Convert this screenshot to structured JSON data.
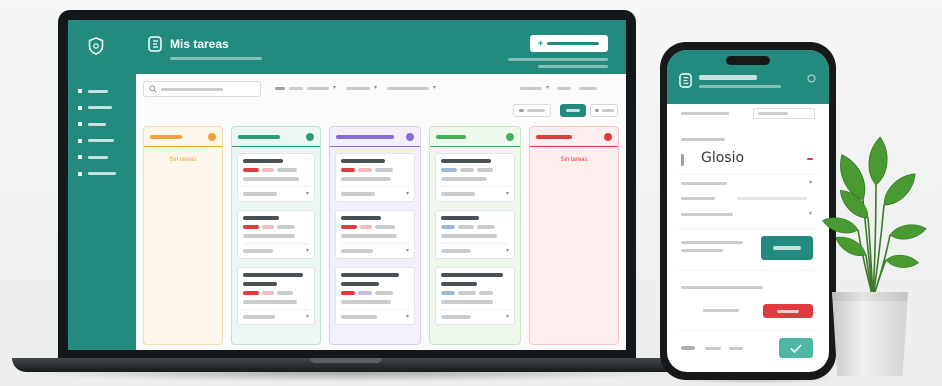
{
  "laptop": {
    "header": {
      "title": "Mis tareas",
      "logo_icon": "shield-icon",
      "app_icon": "board-icon",
      "new_button_icon": "plus-icon"
    },
    "columns": [
      {
        "empty_text": "Sin tareas"
      },
      {},
      {},
      {},
      {
        "empty_text": "Sin tareas"
      }
    ]
  },
  "phone": {
    "field_value": "Glosio"
  },
  "colors": {
    "teal": "#238b7e",
    "orange": "#f0a13b",
    "green2": "#2a9d78",
    "purple": "#8a6ad4",
    "green": "#44b05a",
    "red": "#e23b3f",
    "leaf": "#4a9a32"
  }
}
